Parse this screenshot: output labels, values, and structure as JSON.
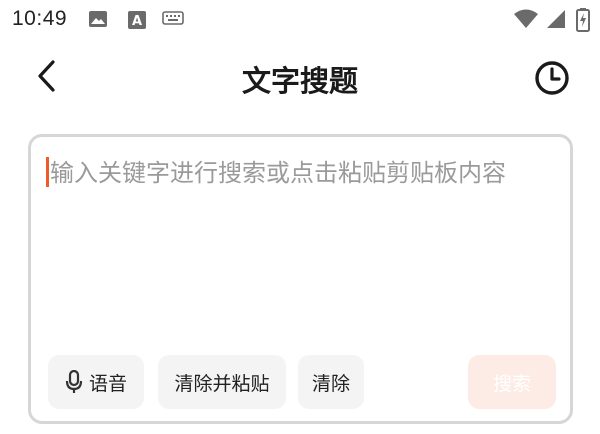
{
  "status_bar": {
    "time": "10:49",
    "icons": [
      "image-icon",
      "text-a-icon",
      "keyboard-icon",
      "wifi-icon",
      "signal-icon",
      "battery-charging-icon"
    ]
  },
  "header": {
    "title": "文字搜题",
    "back_icon": "chevron-left-icon",
    "history_icon": "clock-icon"
  },
  "search": {
    "value": "",
    "placeholder": "输入关键字进行搜索或点击粘贴剪贴板内容"
  },
  "actions": {
    "voice_label": "语音",
    "clear_paste_label": "清除并粘贴",
    "clear_label": "清除",
    "search_label": "搜索"
  },
  "colors": {
    "caret": "#f05a28",
    "search_button_bg": "#fdece6",
    "chip_bg": "#f4f4f4",
    "card_border": "#d6d6d6"
  }
}
